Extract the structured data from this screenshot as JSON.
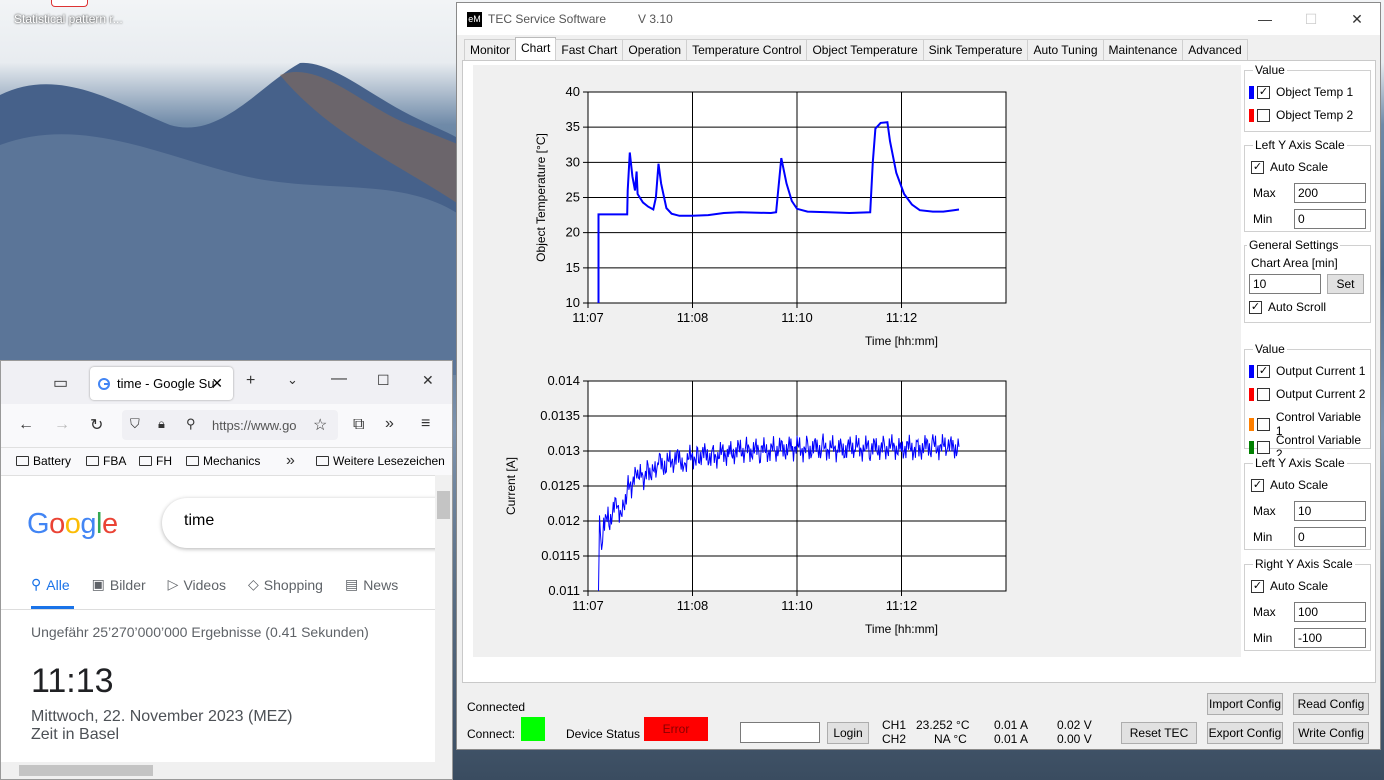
{
  "desktop": {
    "icon_label": "Statistical pattern r..."
  },
  "tec": {
    "title": "TEC Service Software",
    "version": "V 3.10",
    "app_icon": "eM",
    "window_buttons": {
      "minimize": "—",
      "maximize": "☐",
      "close": "✕"
    },
    "tabs": [
      "Monitor",
      "Chart",
      "Fast Chart",
      "Operation",
      "Temperature Control",
      "Object Temperature",
      "Sink Temperature",
      "Auto Tuning",
      "Maintenance",
      "Advanced"
    ],
    "active_tab": "Chart",
    "panel_top": {
      "value_title": "Value",
      "series": [
        {
          "label": "Object Temp 1",
          "color": "#0000ff",
          "checked": true
        },
        {
          "label": "Object Temp 2",
          "color": "#ff0000",
          "checked": false
        }
      ],
      "left_axis_title": "Left Y Axis Scale",
      "auto_scale_label": "Auto Scale",
      "max_label": "Max",
      "max_value": "200",
      "min_label": "Min",
      "min_value": "0",
      "general_title": "General Settings",
      "chart_area_label": "Chart Area [min]",
      "chart_area_value": "10",
      "set_label": "Set",
      "auto_scroll_label": "Auto Scroll"
    },
    "panel_bottom": {
      "value_title": "Value",
      "series": [
        {
          "label": "Output Current 1",
          "color": "#0000ff",
          "checked": true
        },
        {
          "label": "Output Current 2",
          "color": "#ff0000",
          "checked": false
        },
        {
          "label": "Control Variable 1",
          "color": "#ff8000",
          "checked": false
        },
        {
          "label": "Control Variable 2",
          "color": "#008000",
          "checked": false
        }
      ],
      "left_axis_title": "Left Y Axis Scale",
      "left_auto_label": "Auto Scale",
      "left_max_label": "Max",
      "left_max_value": "10",
      "left_min_label": "Min",
      "left_min_value": "0",
      "right_axis_title": "Right Y Axis Scale",
      "right_auto_label": "Auto Scale",
      "right_max_label": "Max",
      "right_max_value": "100",
      "right_min_label": "Min",
      "right_min_value": "-100"
    },
    "status": {
      "connected_text": "Connected",
      "connect_label": "Connect:",
      "connect_color": "#00ff00",
      "device_status_label": "Device Status",
      "device_status_value": "Error",
      "device_status_color": "#ff0000",
      "login_label": "Login",
      "ch1_label": "CH1",
      "ch1_temp": "23.252 °C",
      "ch1_current": "0.01 A",
      "ch1_voltage": "0.02 V",
      "ch2_label": "CH2",
      "ch2_temp": "NA °C",
      "ch2_current": "0.01 A",
      "ch2_voltage": "0.00 V",
      "reset_tec_label": "Reset TEC",
      "import_config_label": "Import Config",
      "export_config_label": "Export Config",
      "read_config_label": "Read Config",
      "write_config_label": "Write Config"
    }
  },
  "chart_data": [
    {
      "type": "line",
      "xlabel": "Time [hh:mm]",
      "ylabel": "Object Temperature [°C]",
      "x_ticks": [
        "11:07",
        "11:08",
        "11:10",
        "11:12"
      ],
      "y_ticks": [
        10,
        15,
        20,
        25,
        30,
        35,
        40
      ],
      "ylim": [
        10,
        40
      ],
      "grid": true,
      "series": [
        {
          "name": "Object Temp 1",
          "color": "#0000ff",
          "points": [
            [
              0.2,
              10
            ],
            [
              0.2,
              22.6
            ],
            [
              0.4,
              22.6
            ],
            [
              0.6,
              22.6
            ],
            [
              0.75,
              22.6
            ],
            [
              0.76,
              26
            ],
            [
              0.8,
              31.4
            ],
            [
              0.85,
              28
            ],
            [
              0.9,
              26
            ],
            [
              0.93,
              28.7
            ],
            [
              0.95,
              25.5
            ],
            [
              1.05,
              24.3
            ],
            [
              1.15,
              23.7
            ],
            [
              1.25,
              23.3
            ],
            [
              1.3,
              25
            ],
            [
              1.35,
              29.8
            ],
            [
              1.4,
              27
            ],
            [
              1.5,
              23.5
            ],
            [
              1.6,
              22.7
            ],
            [
              1.75,
              22.4
            ],
            [
              2.0,
              22.4
            ],
            [
              2.3,
              22.5
            ],
            [
              2.6,
              22.8
            ],
            [
              2.9,
              22.9
            ],
            [
              3.5,
              22.8
            ],
            [
              3.6,
              22.9
            ],
            [
              3.7,
              30.6
            ],
            [
              3.8,
              27
            ],
            [
              3.9,
              24.5
            ],
            [
              4.0,
              23.4
            ],
            [
              4.2,
              23.0
            ],
            [
              4.6,
              22.9
            ],
            [
              5.0,
              22.8
            ],
            [
              5.4,
              22.9
            ],
            [
              5.45,
              30
            ],
            [
              5.5,
              34.8
            ],
            [
              5.6,
              35.6
            ],
            [
              5.73,
              35.7
            ],
            [
              5.78,
              33
            ],
            [
              5.9,
              28.5
            ],
            [
              6.05,
              25.5
            ],
            [
              6.2,
              24
            ],
            [
              6.35,
              23.2
            ],
            [
              6.6,
              23
            ],
            [
              6.8,
              23
            ],
            [
              7.0,
              23.2
            ],
            [
              7.1,
              23.3
            ]
          ]
        }
      ]
    },
    {
      "type": "line",
      "xlabel": "Time [hh:mm]",
      "ylabel": "Current [A]",
      "x_ticks": [
        "11:07",
        "11:08",
        "11:10",
        "11:12"
      ],
      "y_ticks": [
        0.011,
        0.0115,
        0.012,
        0.0125,
        0.013,
        0.0135,
        0.014
      ],
      "ylim": [
        0.011,
        0.014
      ],
      "grid": true,
      "series": [
        {
          "name": "Output Current 1",
          "color": "#0000ff",
          "points": [
            [
              0.2,
              0.011
            ],
            [
              0.22,
              0.01195
            ],
            [
              0.26,
              0.0115
            ],
            [
              0.3,
              0.01205
            ],
            [
              0.4,
              0.012
            ],
            [
              0.55,
              0.01225
            ],
            [
              0.65,
              0.0121
            ],
            [
              0.75,
              0.01245
            ],
            [
              0.85,
              0.0125
            ],
            [
              0.95,
              0.0127
            ],
            [
              1.05,
              0.0126
            ],
            [
              1.15,
              0.01275
            ],
            [
              1.25,
              0.0127
            ],
            [
              1.35,
              0.01285
            ],
            [
              1.5,
              0.0128
            ],
            [
              1.65,
              0.0129
            ],
            [
              1.85,
              0.01285
            ],
            [
              2.1,
              0.01295
            ],
            [
              2.4,
              0.01293
            ],
            [
              2.7,
              0.01298
            ],
            [
              3.0,
              0.01302
            ],
            [
              3.3,
              0.013
            ],
            [
              3.6,
              0.01302
            ],
            [
              3.9,
              0.01305
            ],
            [
              4.2,
              0.01303
            ],
            [
              4.5,
              0.01305
            ],
            [
              4.8,
              0.01302
            ],
            [
              5.1,
              0.01305
            ],
            [
              5.4,
              0.01303
            ],
            [
              5.7,
              0.01306
            ],
            [
              6.0,
              0.01305
            ],
            [
              6.3,
              0.01304
            ],
            [
              6.6,
              0.01307
            ],
            [
              6.9,
              0.01305
            ],
            [
              7.1,
              0.01306
            ]
          ]
        }
      ]
    }
  ],
  "browser": {
    "tab_title": "time - Google Su",
    "url": "https://www.go",
    "bookmarks": [
      "Battery",
      "FBA",
      "FH",
      "Mechanics"
    ],
    "more_bookmarks": "Weitere Lesezeichen",
    "logo": "Google",
    "query": "time",
    "result_tabs": [
      "Alle",
      "Bilder",
      "Videos",
      "Shopping",
      "News"
    ],
    "result_count": "Ungefähr 25’270’000’000 Ergebnisse (0.41 Sekunden)",
    "clock": "11:13",
    "date": "Mittwoch, 22. November 2023 (MEZ)",
    "place": "Zeit in Basel"
  }
}
